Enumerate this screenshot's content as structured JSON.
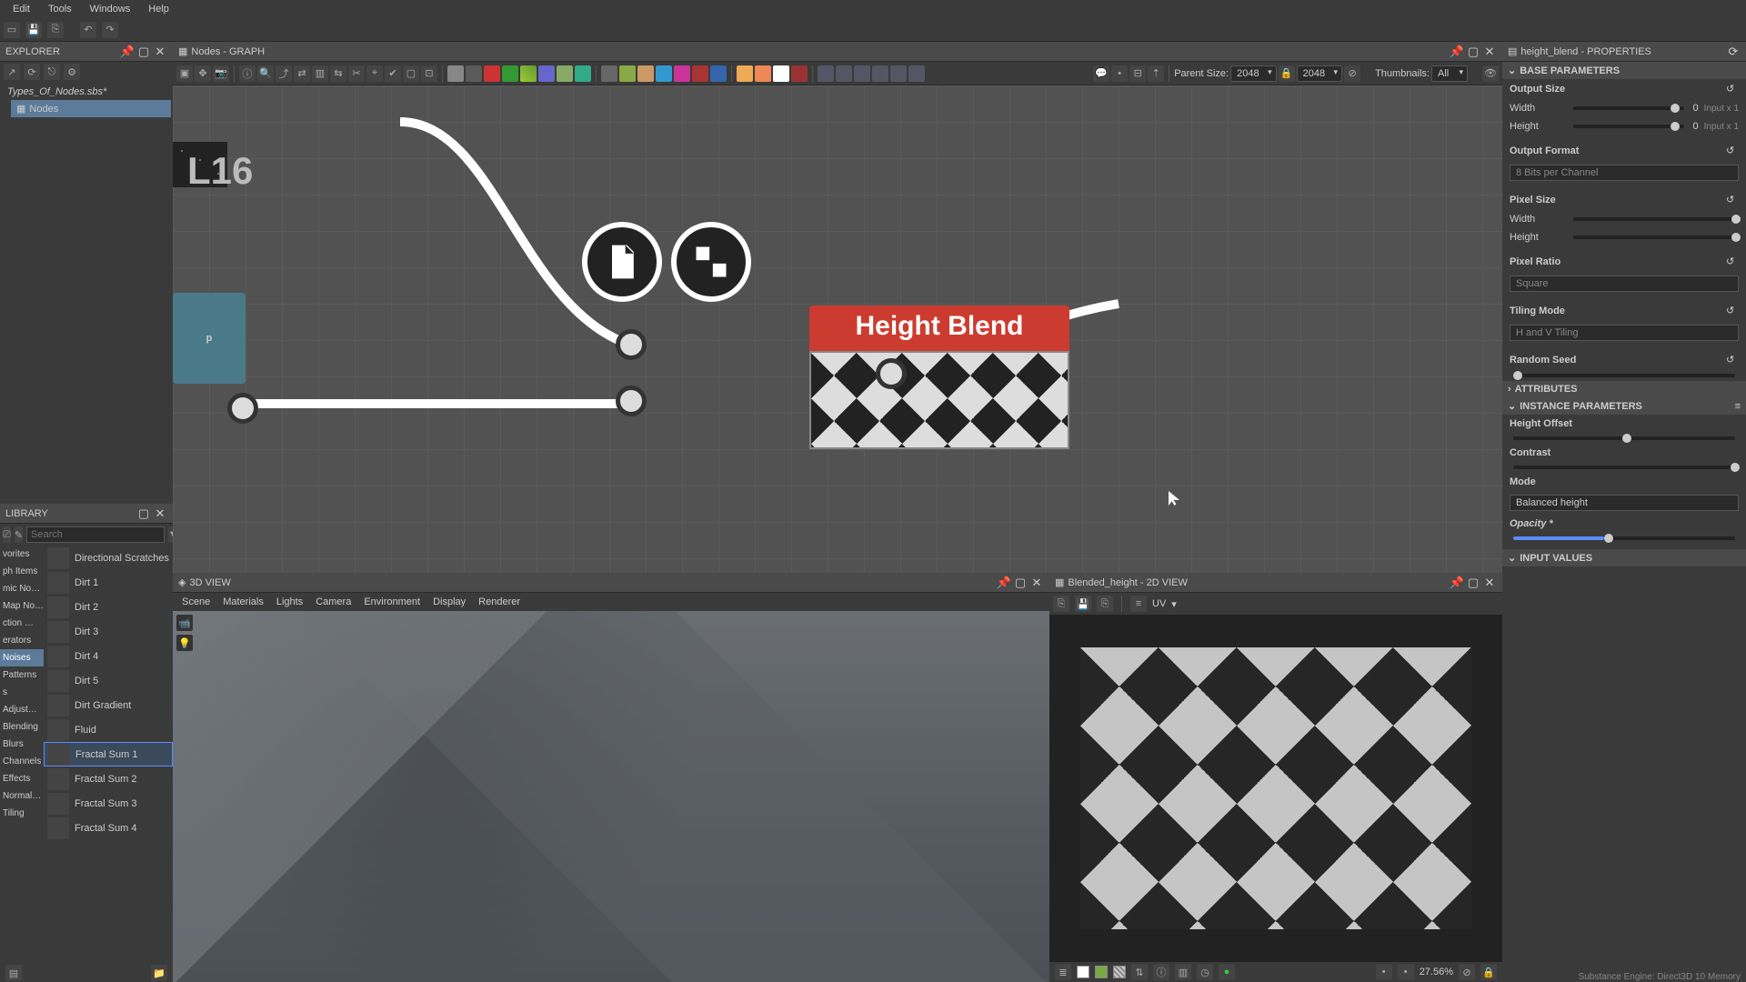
{
  "menubar": [
    "Edit",
    "Tools",
    "Windows",
    "Help"
  ],
  "explorer": {
    "title": "EXPLORER",
    "file": "Types_Of_Nodes.sbs*",
    "child": "Nodes"
  },
  "graph": {
    "title": "Nodes - GRAPH",
    "parent_size_label": "Parent Size:",
    "parent_w": "2048",
    "parent_h": "2048",
    "thumb_label": "Thumbnails:",
    "thumb_value": "All",
    "big_label": "L16",
    "partial_node_label": "p",
    "hb_title": "Height Blend"
  },
  "library": {
    "title": "LIBRARY",
    "search_placeholder": "Search",
    "categories": [
      "vorites",
      "ph Items",
      "mic No…",
      "Map No…",
      "ction …",
      "erators",
      "Noises",
      "Patterns",
      "s",
      "Adjust…",
      "Blending",
      "Blurs",
      "Channels",
      "Effects",
      "Normal…",
      "Tiling"
    ],
    "selected_cat": "Noises",
    "items": [
      "Directional Scratches",
      "Dirt 1",
      "Dirt 2",
      "Dirt 3",
      "Dirt 4",
      "Dirt 5",
      "Dirt Gradient",
      "Fluid",
      "Fractal Sum 1",
      "Fractal Sum 2",
      "Fractal Sum 3",
      "Fractal Sum 4"
    ],
    "selected_item": "Fractal Sum 1"
  },
  "view3d": {
    "title": "3D VIEW",
    "menus": [
      "Scene",
      "Materials",
      "Lights",
      "Camera",
      "Environment",
      "Display",
      "Renderer"
    ]
  },
  "view2d": {
    "title": "Blended_height - 2D VIEW",
    "uv_label": "UV",
    "zoom": "27.56%"
  },
  "properties": {
    "title": "height_blend - PROPERTIES",
    "sections": {
      "base": "BASE PARAMETERS",
      "attributes": "ATTRIBUTES",
      "instance": "INSTANCE PARAMETERS",
      "input": "INPUT VALUES"
    },
    "output_size": "Output Size",
    "width": "Width",
    "height": "Height",
    "width_val": "0",
    "height_val": "0",
    "width_suffix": "Input x 1",
    "height_suffix": "Input x 1",
    "output_format": "Output Format",
    "output_format_val": "8 Bits per Channel",
    "pixel_size": "Pixel Size",
    "pixel_ratio": "Pixel Ratio",
    "pixel_ratio_val": "Square",
    "tiling_mode": "Tiling Mode",
    "tiling_mode_val": "H and V Tiling",
    "random_seed": "Random Seed",
    "height_offset": "Height Offset",
    "contrast": "Contrast",
    "mode": "Mode",
    "mode_val": "Balanced height",
    "opacity": "Opacity *"
  },
  "footer": "Substance Engine: Direct3D 10   Memory"
}
